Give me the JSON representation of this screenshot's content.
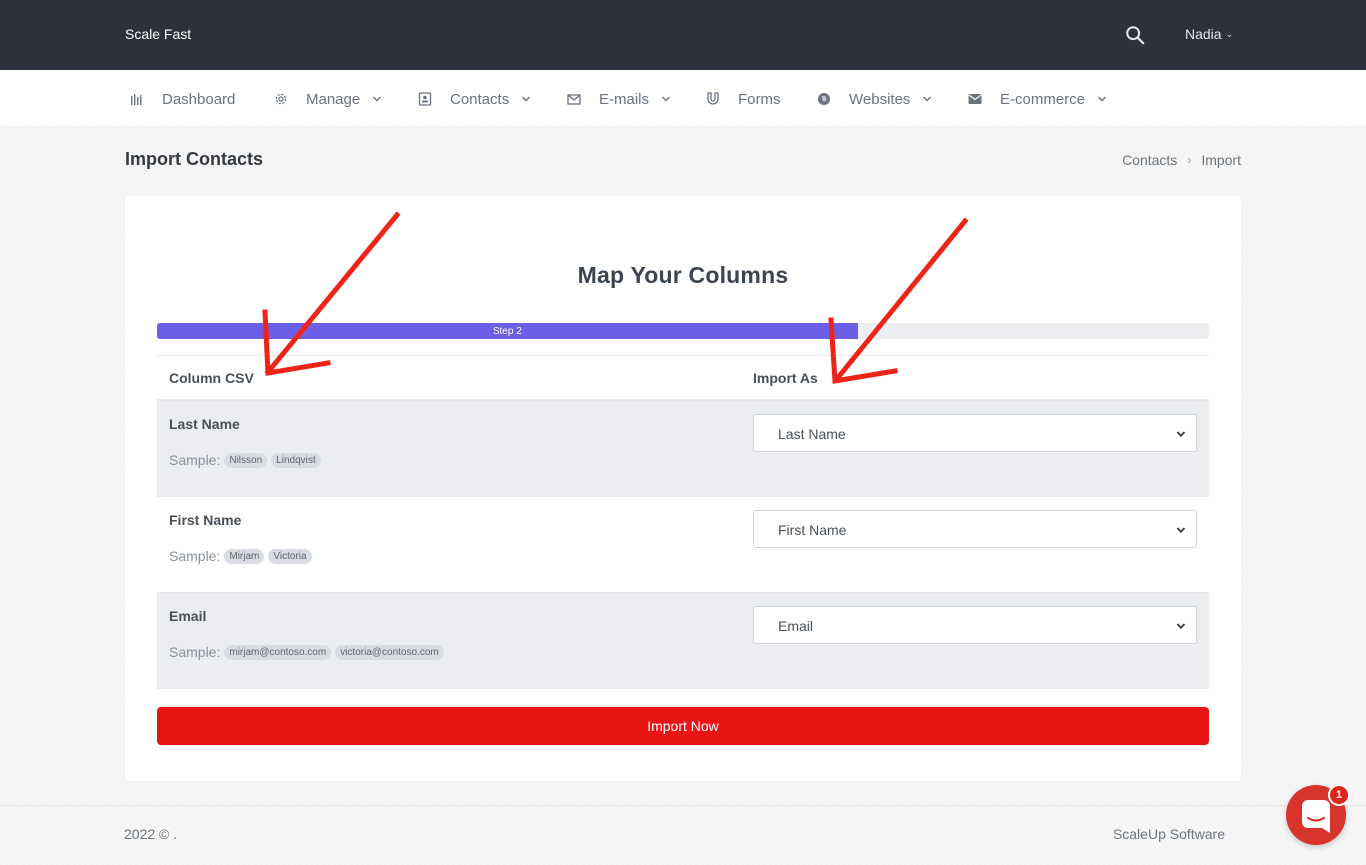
{
  "topbar": {
    "brand": "Scale Fast",
    "search_icon": "search-icon",
    "user_name": "Nadia"
  },
  "nav": {
    "items": [
      {
        "label": "Dashboard",
        "icon": "bar-chart-icon",
        "has_dropdown": false
      },
      {
        "label": "Manage",
        "icon": "gear-icon",
        "has_dropdown": true
      },
      {
        "label": "Contacts",
        "icon": "contact-card-icon",
        "has_dropdown": true
      },
      {
        "label": "E-mails",
        "icon": "envelope-open-icon",
        "has_dropdown": true
      },
      {
        "label": "Forms",
        "icon": "magnet-icon",
        "has_dropdown": false
      },
      {
        "label": "Websites",
        "icon": "globe-icon",
        "has_dropdown": true
      },
      {
        "label": "E-commerce",
        "icon": "envelope-icon",
        "has_dropdown": true
      }
    ]
  },
  "page": {
    "title": "Import Contacts",
    "breadcrumb": [
      "Contacts",
      "Import"
    ]
  },
  "card": {
    "heading": "Map Your Columns",
    "progress": {
      "label": "Step 2",
      "percent": 66.6
    },
    "columns": {
      "csv": "Column CSV",
      "import_as": "Import As"
    },
    "sample_label": "Sample:",
    "rows": [
      {
        "name": "Last Name",
        "samples": [
          "Nilsson",
          "Lindqvist"
        ],
        "selected": "Last Name"
      },
      {
        "name": "First Name",
        "samples": [
          "Mirjam",
          "Victoria"
        ],
        "selected": "First Name"
      },
      {
        "name": "Email",
        "samples": [
          "mirjam@contoso.com",
          "victoria@contoso.com"
        ],
        "selected": "Email"
      }
    ],
    "submit_label": "Import Now"
  },
  "footer": {
    "copyright": "2022 © .",
    "company": "ScaleUp Software"
  },
  "chat": {
    "badge_count": "1"
  },
  "colors": {
    "topbar": "#2d303d",
    "progress": "#6c5ee6",
    "primary_button": "#ea1414",
    "annotation_arrow": "#ee2418",
    "chat": "#d9342b"
  }
}
